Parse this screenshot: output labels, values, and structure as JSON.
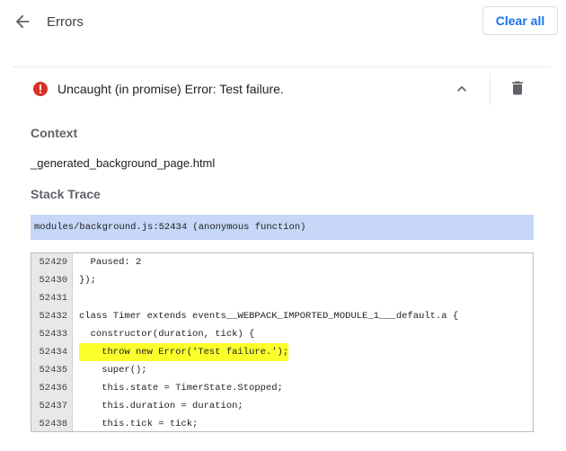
{
  "header": {
    "title": "Errors",
    "clear_all_label": "Clear all"
  },
  "error": {
    "message": "Uncaught (in promise) Error: Test failure.",
    "accent_color": "#d93025"
  },
  "context": {
    "label": "Context",
    "value": "_generated_background_page.html"
  },
  "stack_trace": {
    "label": "Stack Trace",
    "frame": "modules/background.js:52434 (anonymous function)"
  },
  "code": {
    "lines": [
      {
        "num": "52429",
        "text": "  Paused: 2"
      },
      {
        "num": "52430",
        "text": "});"
      },
      {
        "num": "52431",
        "text": ""
      },
      {
        "num": "52432",
        "text": "class Timer extends events__WEBPACK_IMPORTED_MODULE_1___default.a {"
      },
      {
        "num": "52433",
        "text": "  constructor(duration, tick) {"
      },
      {
        "num": "52434",
        "text": "    throw new Error('Test failure.');"
      },
      {
        "num": "52435",
        "text": "    super();"
      },
      {
        "num": "52436",
        "text": "    this.state = TimerState.Stopped;"
      },
      {
        "num": "52437",
        "text": "    this.duration = duration;"
      },
      {
        "num": "52438",
        "text": "    this.tick = tick;"
      }
    ],
    "highlight_color": "#fbff2a"
  },
  "icons": {
    "back": "arrow-back-icon",
    "error": "error-circle-icon",
    "collapse": "chevron-up-icon",
    "delete": "trash-icon"
  }
}
